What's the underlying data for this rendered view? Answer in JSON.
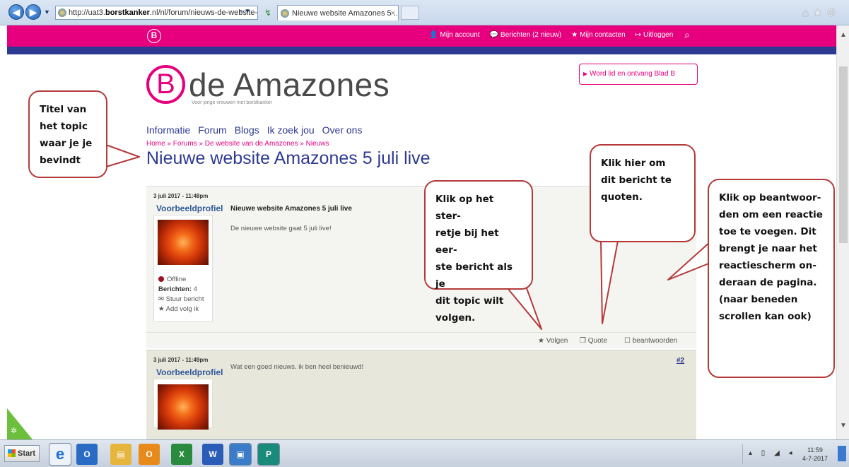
{
  "browser": {
    "url_prefix": "http://uat3.",
    "url_host": "borstkanker",
    "url_suffix": ".nl/nl/forum/nieuws-de-website-",
    "tab_title": "Nieuwe website Amazones 5 ...",
    "tab_close": "×",
    "back_glyph": "◀",
    "forward_glyph": "▶",
    "dropdown_glyph": "▼",
    "search_glyph": "⌕ ▾",
    "refresh_glyph": "↯",
    "right_icons": "⌂★⚙"
  },
  "site_header": {
    "mark": "B",
    "top_menu": [
      {
        "icon": "👤",
        "label": "Mijn account"
      },
      {
        "icon": "💬",
        "label": "Berichten (2 nieuw)"
      },
      {
        "icon": "★",
        "label": "Mijn contacten"
      },
      {
        "icon": "↦",
        "label": "Uitloggen"
      }
    ],
    "search_icon": "⌕"
  },
  "logo": {
    "letter": "B",
    "name": "de Amazones",
    "tagline": "Voor jonge vrouwen met borstkanker"
  },
  "join_button": {
    "caret": "▶",
    "label": "Word lid en ontvang Blad B"
  },
  "main_nav": [
    "Informatie",
    "Forum",
    "Blogs",
    "Ik zoek jou",
    "Over ons"
  ],
  "breadcrumb": "Home » Forums » De website van de Amazones » Nieuws",
  "topic_title": "Nieuwe website Amazones 5 juli live",
  "posts": [
    {
      "date": "3 juli 2017 - 11:48pm",
      "author": "Voorbeeldprofiel",
      "subject": "Nieuwe website Amazones 5 juli live",
      "body": "De nieuwe website gaat 5 juli live!",
      "status": "Offline",
      "messages_label": "Berichten:",
      "messages_count": "4",
      "send_message": "Stuur bericht",
      "add_follow": "Add volg ik",
      "actions": {
        "follow": "Volgen",
        "quote": "Quote",
        "reply": "beantwoorden"
      }
    },
    {
      "date": "3 juli 2017 - 11:49pm",
      "author": "Voorbeeldprofiel",
      "body": "Wat een goed nieuws. ik ben heel benieuwd!",
      "number": "#2"
    }
  ],
  "callouts": {
    "title": [
      "Titel van",
      "het topic",
      "waar je je",
      "bevindt"
    ],
    "follow": [
      "Klik op het ster-",
      "retje bij het eer-",
      "ste bericht als je",
      "dit topic wilt",
      "volgen."
    ],
    "quote": [
      "Klik hier om",
      "dit bericht te",
      "quoten."
    ],
    "reply": [
      "Klik op beantwoor-",
      "den om een reactie",
      "toe te voegen.  Dit",
      "brengt je naar het",
      "reactiescherm on-",
      "deraan de pagina.",
      "(naar beneden",
      "scrollen kan ook)"
    ]
  },
  "taskbar": {
    "start_label": "Start",
    "apps": [
      {
        "name": "ie",
        "glyph": "e",
        "color": "#1e6fd6"
      },
      {
        "name": "outlook",
        "glyph": "O",
        "color": "#2a6bc4"
      },
      {
        "name": "explorer",
        "glyph": "▤",
        "color": "#e5b53e"
      },
      {
        "name": "outlook-mail",
        "glyph": "O",
        "color": "#e88a1a"
      },
      {
        "name": "excel",
        "glyph": "X",
        "color": "#2a8a3e"
      },
      {
        "name": "word",
        "glyph": "W",
        "color": "#2b5cb8"
      },
      {
        "name": "screenshot",
        "glyph": "▣",
        "color": "#3a7cc8"
      },
      {
        "name": "publisher",
        "glyph": "P",
        "color": "#1a8a7a"
      }
    ],
    "tray_icons": "▴ ▯ ◢ ◂",
    "time": "11:59",
    "date": "4-7-2017"
  }
}
